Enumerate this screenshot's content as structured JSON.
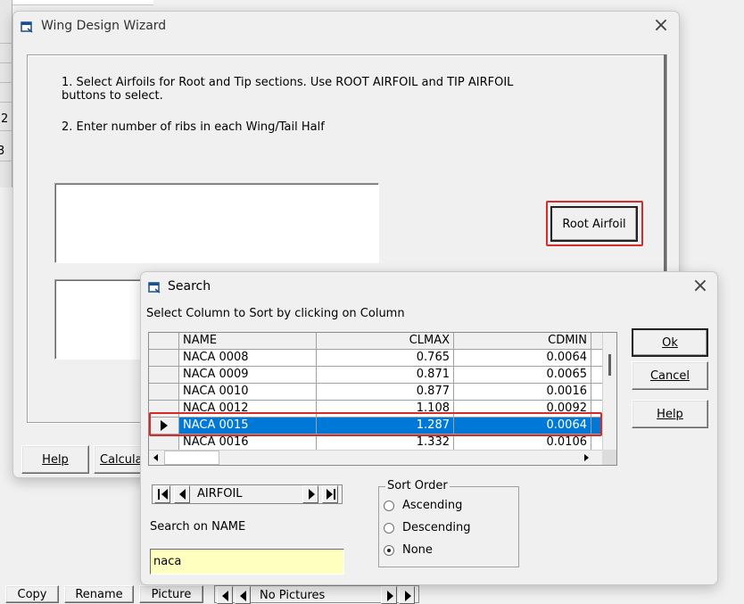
{
  "wizard": {
    "title": "Wing Design Wizard",
    "instruction_1": "1. Select Airfoils for Root and Tip sections. Use ROOT AIRFOIL and TIP AIRFOIL buttons to select.",
    "instruction_2": "2. Enter number of ribs in each Wing/Tail Half",
    "root_airfoil_label": "Root Airfoil",
    "help_label": "Help",
    "calculate_label_partial": "Calcula"
  },
  "background": {
    "left_numbers": [
      "2",
      "3"
    ],
    "taskbar_buttons": [
      "Copy",
      "Rename",
      "Picture"
    ],
    "pictures_nav_text": "No Pictures"
  },
  "search": {
    "title": "Search",
    "instruction": "Select Column to Sort by clicking on Column",
    "ok_label": "Ok",
    "cancel_label": "Cancel",
    "help_label": "Help",
    "columns": [
      "NAME",
      "CLMAX",
      "CDMIN"
    ],
    "rows": [
      {
        "name": "NACA 0008",
        "clmax": "0.765",
        "cdmin": "0.0064"
      },
      {
        "name": "NACA 0009",
        "clmax": "0.871",
        "cdmin": "0.0065"
      },
      {
        "name": "NACA 0010",
        "clmax": "0.877",
        "cdmin": "0.0016"
      },
      {
        "name": "NACA 0012",
        "clmax": "1.108",
        "cdmin": "0.0092"
      },
      {
        "name": "NACA 0015",
        "clmax": "1.287",
        "cdmin": "0.0064"
      },
      {
        "name": "NACA 0016",
        "clmax": "1.332",
        "cdmin": "0.0106"
      }
    ],
    "selected_row": 4,
    "nav_table": "AIRFOIL",
    "search_on_label": "Search on NAME",
    "search_value": "naca",
    "sort_order": {
      "label": "Sort Order",
      "options": [
        "Ascending",
        "Descending",
        "None"
      ],
      "selected": "None"
    }
  },
  "colors": {
    "selection": "#0078d7",
    "highlight_box": "#d42b2b",
    "search_input_bg": "#ffffc0"
  }
}
